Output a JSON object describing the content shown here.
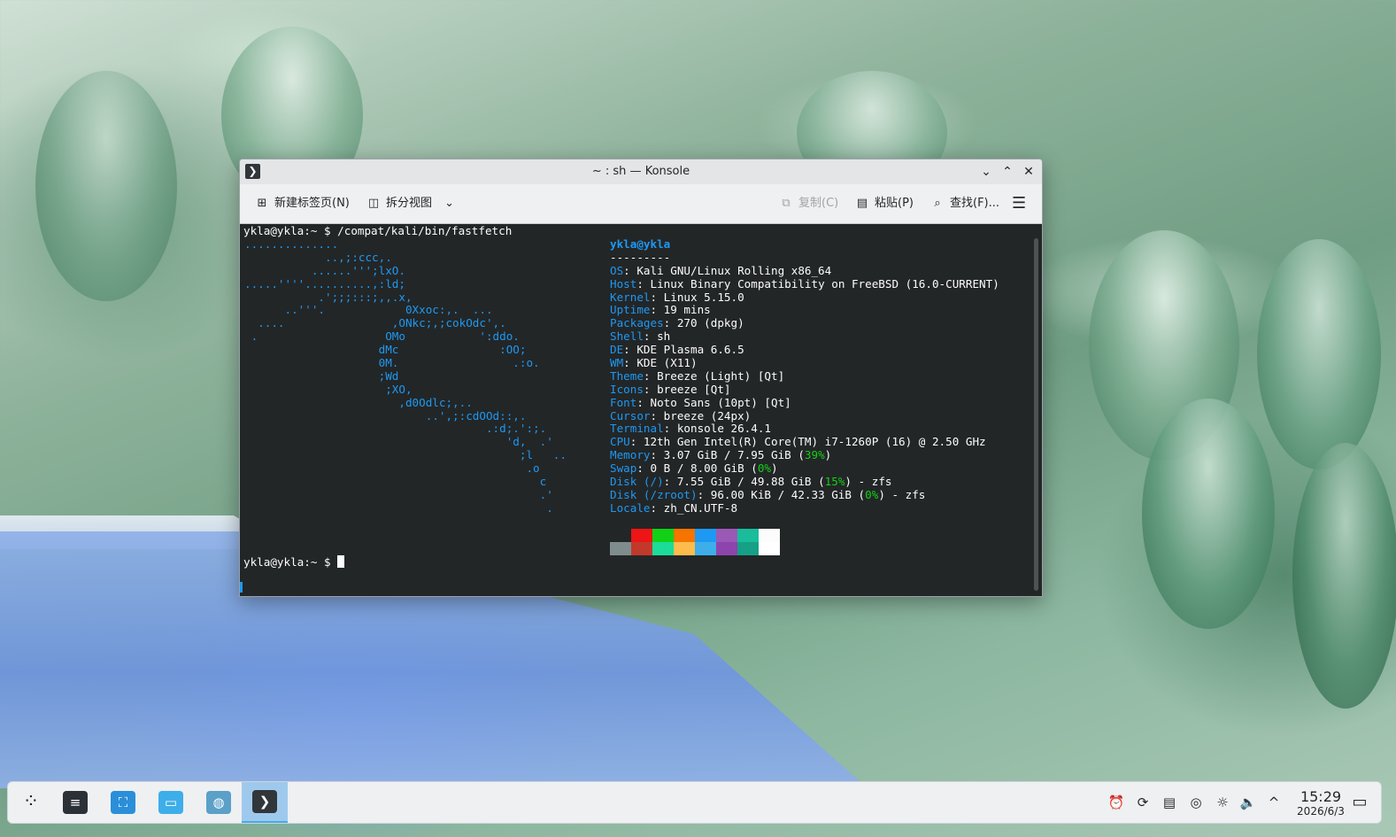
{
  "window": {
    "title": "~ : sh — Konsole",
    "app_icon_glyph": "❯",
    "minimize_glyph": "⌄",
    "maximize_glyph": "⌃",
    "close_glyph": "✕"
  },
  "toolbar": {
    "new_tab": "新建标签页(N)",
    "split_view": "拆分视图",
    "copy": "复制(C)",
    "paste": "粘贴(P)",
    "find": "查找(F)...",
    "menu_glyph": "☰",
    "dropdown_glyph": "⌄"
  },
  "terminal": {
    "command_line": "ykla@ykla:~ $ /compat/kali/bin/fastfetch",
    "prompt": "ykla@ykla:~ $ ",
    "logo_lines": [
      "..............",
      "            ..,;:ccc,.",
      "          ......''';lxO.",
      ".....''''..........,:ld;",
      "           .';;;:::;,,.x,",
      "      ..'''.            0Xxoc:,.  ...",
      "  ....                ,ONkc;,;cokOdc',.",
      " .                   OMo           ':ddo.",
      "                    dMc               :OO;",
      "                    0M.                 .:o.",
      "                    ;Wd",
      "                     ;XO,",
      "                       ,d0Odlc;,..",
      "                           ..',;:cdOOd::,.",
      "                                    .:d;.':;.",
      "                                       'd,  .'",
      "                                         ;l   ..",
      "                                          .o",
      "                                            c",
      "                                            .'",
      "                                             ."
    ],
    "user_host": "ykla@ykla",
    "separator": "---------",
    "info": [
      {
        "key": "OS",
        "value": "Kali GNU/Linux Rolling x86_64"
      },
      {
        "key": "Host",
        "value": "Linux Binary Compatibility on FreeBSD (16.0-CURRENT)"
      },
      {
        "key": "Kernel",
        "value": "Linux 5.15.0"
      },
      {
        "key": "Uptime",
        "value": "19 mins"
      },
      {
        "key": "Packages",
        "value": "270 (dpkg)"
      },
      {
        "key": "Shell",
        "value": "sh"
      },
      {
        "key": "DE",
        "value": "KDE Plasma 6.6.5"
      },
      {
        "key": "WM",
        "value": "KDE (X11)"
      },
      {
        "key": "Theme",
        "value": "Breeze (Light) [Qt]"
      },
      {
        "key": "Icons",
        "value": "breeze [Qt]"
      },
      {
        "key": "Font",
        "value": "Noto Sans (10pt) [Qt]"
      },
      {
        "key": "Cursor",
        "value": "breeze (24px)"
      },
      {
        "key": "Terminal",
        "value": "konsole 26.4.1"
      },
      {
        "key": "CPU",
        "value": "12th Gen Intel(R) Core(TM) i7-1260P (16) @ 2.50 GHz"
      }
    ],
    "memory": {
      "key": "Memory",
      "pre": "3.07 GiB / 7.95 GiB (",
      "pct": "39%",
      "post": ")"
    },
    "swap": {
      "key": "Swap",
      "pre": "0 B / 8.00 GiB (",
      "pct": "0%",
      "post": ")"
    },
    "disk_root": {
      "key": "Disk (/)",
      "pre": "7.55 GiB / 49.88 GiB (",
      "pct": "15%",
      "post": ") - zfs"
    },
    "disk_zroot": {
      "key": "Disk (/zroot)",
      "pre": "96.00 KiB / 42.33 GiB (",
      "pct": "0%",
      "post": ") - zfs"
    },
    "locale": {
      "key": "Locale",
      "value": "zh_CN.UTF-8"
    },
    "palette_top": [
      "#232627",
      "#ed1515",
      "#11d116",
      "#f67400",
      "#1d99f3",
      "#9b59b6",
      "#1abc9c",
      "#fcfcfc"
    ],
    "palette_bottom": [
      "#7f8c8d",
      "#c0392b",
      "#1cdc9a",
      "#fdbc4b",
      "#3daee9",
      "#8e44ad",
      "#16a085",
      "#ffffff"
    ]
  },
  "taskbar": {
    "launchers": [
      {
        "name": "application-launcher-icon",
        "glyph": "⁘",
        "bg": "#eef0f2",
        "fg": "#232629"
      },
      {
        "name": "system-settings-icon",
        "glyph": "≡",
        "bg": "#2b3137",
        "fg": "#ffffff"
      },
      {
        "name": "discover-store-icon",
        "glyph": "⛶",
        "bg": "#2a8fd8",
        "fg": "#ffffff"
      },
      {
        "name": "file-manager-icon",
        "glyph": "▭",
        "bg": "#3daee9",
        "fg": "#ffffff"
      },
      {
        "name": "web-browser-icon",
        "glyph": "◍",
        "bg": "#5aa0c8",
        "fg": "#ffffff"
      },
      {
        "name": "konsole-task-icon",
        "glyph": "❯",
        "bg": "#31363b",
        "fg": "#ffffff"
      }
    ],
    "tray": [
      {
        "name": "notifications-icon",
        "glyph": "⏰"
      },
      {
        "name": "update-icon",
        "glyph": "⟳"
      },
      {
        "name": "clipboard-icon",
        "glyph": "▤"
      },
      {
        "name": "media-icon",
        "glyph": "◎"
      },
      {
        "name": "brightness-icon",
        "glyph": "☼"
      },
      {
        "name": "volume-icon",
        "glyph": "🔈"
      },
      {
        "name": "show-hidden-icon",
        "glyph": "^"
      }
    ],
    "clock_time": "15:29",
    "clock_date": "2026/6/3",
    "desktop_glyph": "▭"
  }
}
